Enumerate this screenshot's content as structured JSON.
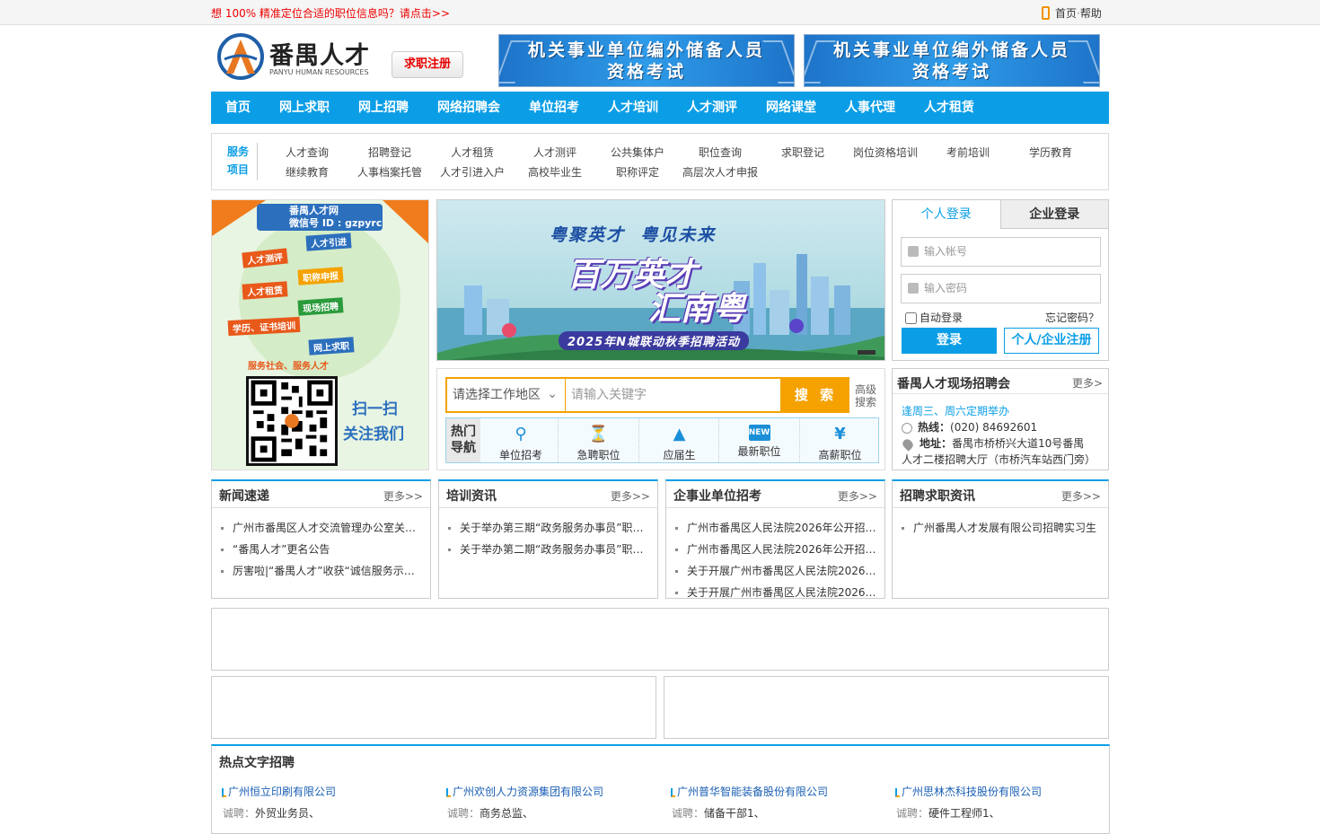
{
  "topbar": {
    "promo": "想 100% 精准定位合适的职位信息吗？请点击>>",
    "home": "首页",
    "sep": "·",
    "help": "帮助"
  },
  "header": {
    "logo_cn": "番禺人才",
    "logo_en": "PANYU HUMAN RESOURCES",
    "register_btn": "求职注册",
    "banners": [
      {
        "line1": "机关事业单位编外储备人员",
        "line2": "资格考试"
      },
      {
        "line1": "机关事业单位编外储备人员",
        "line2": "资格考试"
      }
    ]
  },
  "nav": [
    "首页",
    "网上求职",
    "网上招聘",
    "网络招聘会",
    "单位招考",
    "人才培训",
    "人才测评",
    "网络课堂",
    "人事代理",
    "人才租赁"
  ],
  "services": {
    "label1": "服务",
    "label2": "项目",
    "items": [
      "人才查询",
      "招聘登记",
      "人才租赁",
      "人才测评",
      "公共集体户",
      "职位查询",
      "求职登记",
      "岗位资格培训",
      "考前培训",
      "学历教育",
      "继续教育",
      "人事档案托管",
      "人才引进入户",
      "高校毕业生",
      "职称评定",
      "高层次人才申报"
    ]
  },
  "wechat": {
    "site": "番禺人才网",
    "wx": "微信号 ID : gzpyrc",
    "tags": [
      "人才引进",
      "人才测评",
      "职称申报",
      "人才租赁",
      "现场招聘",
      "学历、证书培训",
      "网上求职"
    ],
    "slogan": "服务社会、服务人才",
    "scan": "扫一扫",
    "follow": "关注我们"
  },
  "hero": {
    "line1": "粤聚英才  粤见未来",
    "line2": "百万英才",
    "line3": "汇南粤",
    "line4": "2025年N城联动秋季招聘活动"
  },
  "login": {
    "tab_personal": "个人登录",
    "tab_company": "企业登录",
    "account_ph": "输入帐号",
    "password_ph": "输入密码",
    "remember": "自动登录",
    "forgot": "忘记密码？",
    "login_btn": "登录",
    "register_btn": "个人/企业注册"
  },
  "search": {
    "region": "请选择工作地区",
    "keyword_ph": "请输入关键字",
    "btn": "搜 索",
    "adv1": "高级",
    "adv2": "搜索",
    "hot_label1": "热门",
    "hot_label2": "导航",
    "hot": [
      {
        "icon": "search-person-icon",
        "label": "单位招考"
      },
      {
        "icon": "urgent-icon",
        "label": "急聘职位"
      },
      {
        "icon": "graduate-cap-icon",
        "label": "应届生"
      },
      {
        "icon": "new-folder-icon",
        "label": "最新职位"
      },
      {
        "icon": "money-bag-icon",
        "label": "高薪职位"
      }
    ]
  },
  "fairs": {
    "title": "番禺人才现场招聘会",
    "more": "更多>",
    "schedule": "逢周三、周六定期举办",
    "hotline_label": "热线：",
    "hotline": "(020)  84692601",
    "addr_label": "地址：",
    "addr1": "番禺市桥桥兴大道10号番禺",
    "addr2": "人才二楼招聘大厅（市桥汽车站西门旁）"
  },
  "news": [
    {
      "title": "新闻速递",
      "more": "更多>>",
      "items": [
        "广州市番禺区人才交流管理办公室关于…",
        "“番禺人才”更名公告",
        "厉害啦|“番禺人才”收获“诚信服务示范…"
      ]
    },
    {
      "title": "培训资讯",
      "more": "更多>>",
      "items": [
        "关于举办第三期“政务服务办事员”职业…",
        "关于举办第二期“政务服务办事员”职业…"
      ]
    },
    {
      "title": "企事业单位招考",
      "more": "更多>>",
      "items": [
        "广州市番禺区人民法院2026年公开招…",
        "广州市番禺区人民法院2026年公开招…",
        "关于开展广州市番禺区人民法院2026…",
        "关于开展广州市番禺区人民法院2026…"
      ]
    },
    {
      "title": "招聘求职资讯",
      "more": "更多>>",
      "items": [
        "广州番禺人才发展有限公司招聘实习生"
      ]
    }
  ],
  "hotjobs": {
    "title": "热点文字招聘",
    "recruit_label": "诚聘：",
    "companies": [
      {
        "name": "广州恒立印刷有限公司",
        "jobs": "外贸业务员、"
      },
      {
        "name": "广州欢创人力资源集团有限公司",
        "jobs": "商务总监、"
      },
      {
        "name": "广州普华智能装备股份有限公司",
        "jobs": "储备干部1、"
      },
      {
        "name": "广州思林杰科技股份有限公司",
        "jobs": "硬件工程师1、"
      }
    ]
  },
  "colors": {
    "accent": "#0b9ee6",
    "orange": "#f5a200",
    "promo_red": "#e00000"
  }
}
